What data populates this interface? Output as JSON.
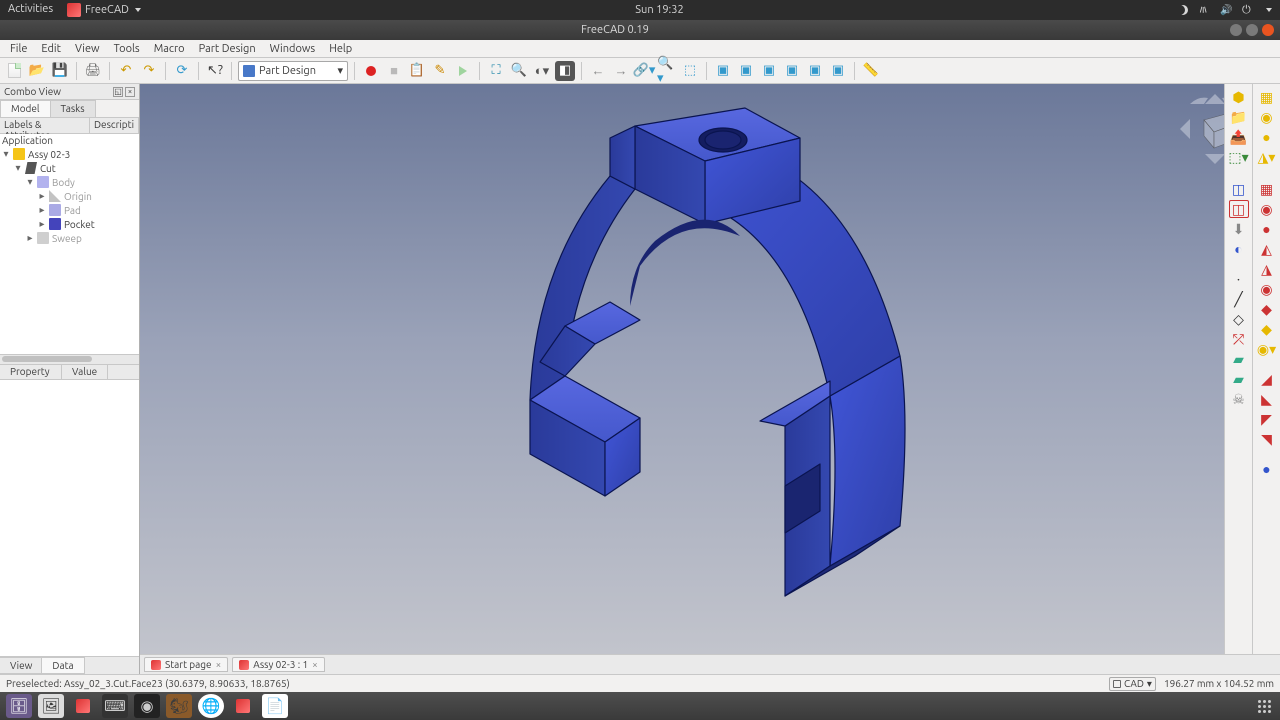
{
  "ubuntu": {
    "activities": "Activities",
    "app_name": "FreeCAD",
    "clock": "Sun 19:32"
  },
  "window": {
    "title": "FreeCAD 0.19"
  },
  "menus": [
    "File",
    "Edit",
    "View",
    "Tools",
    "Macro",
    "Part Design",
    "Windows",
    "Help"
  ],
  "workbench": {
    "label": "Part Design"
  },
  "combo": {
    "title": "Combo View",
    "tabs": {
      "model": "Model",
      "tasks": "Tasks"
    },
    "tree_header": {
      "labels": "Labels & Attributes",
      "desc": "Descripti"
    },
    "tree": {
      "root": "Application",
      "doc": "Assy 02-3",
      "cut": "Cut",
      "body": "Body",
      "origin": "Origin",
      "pad": "Pad",
      "pocket": "Pocket",
      "sweep": "Sweep"
    },
    "prop_header": {
      "property": "Property",
      "value": "Value"
    },
    "bottom_tabs": {
      "view": "View",
      "data": "Data"
    }
  },
  "doc_tabs": [
    {
      "label": "Start page",
      "icon": "fc"
    },
    {
      "label": "Assy 02-3 : 1",
      "icon": "fc"
    }
  ],
  "status": {
    "preselected": "Preselected: Assy_02_3.Cut.Face23 (30.6379, 8.90633, 18.8765)",
    "cad": "CAD",
    "dims": "196.27 mm x 104.52 mm"
  },
  "icons": {
    "close": "×",
    "dropdown": "▾",
    "back": "←",
    "fwd": "→",
    "refresh": "⟳"
  }
}
